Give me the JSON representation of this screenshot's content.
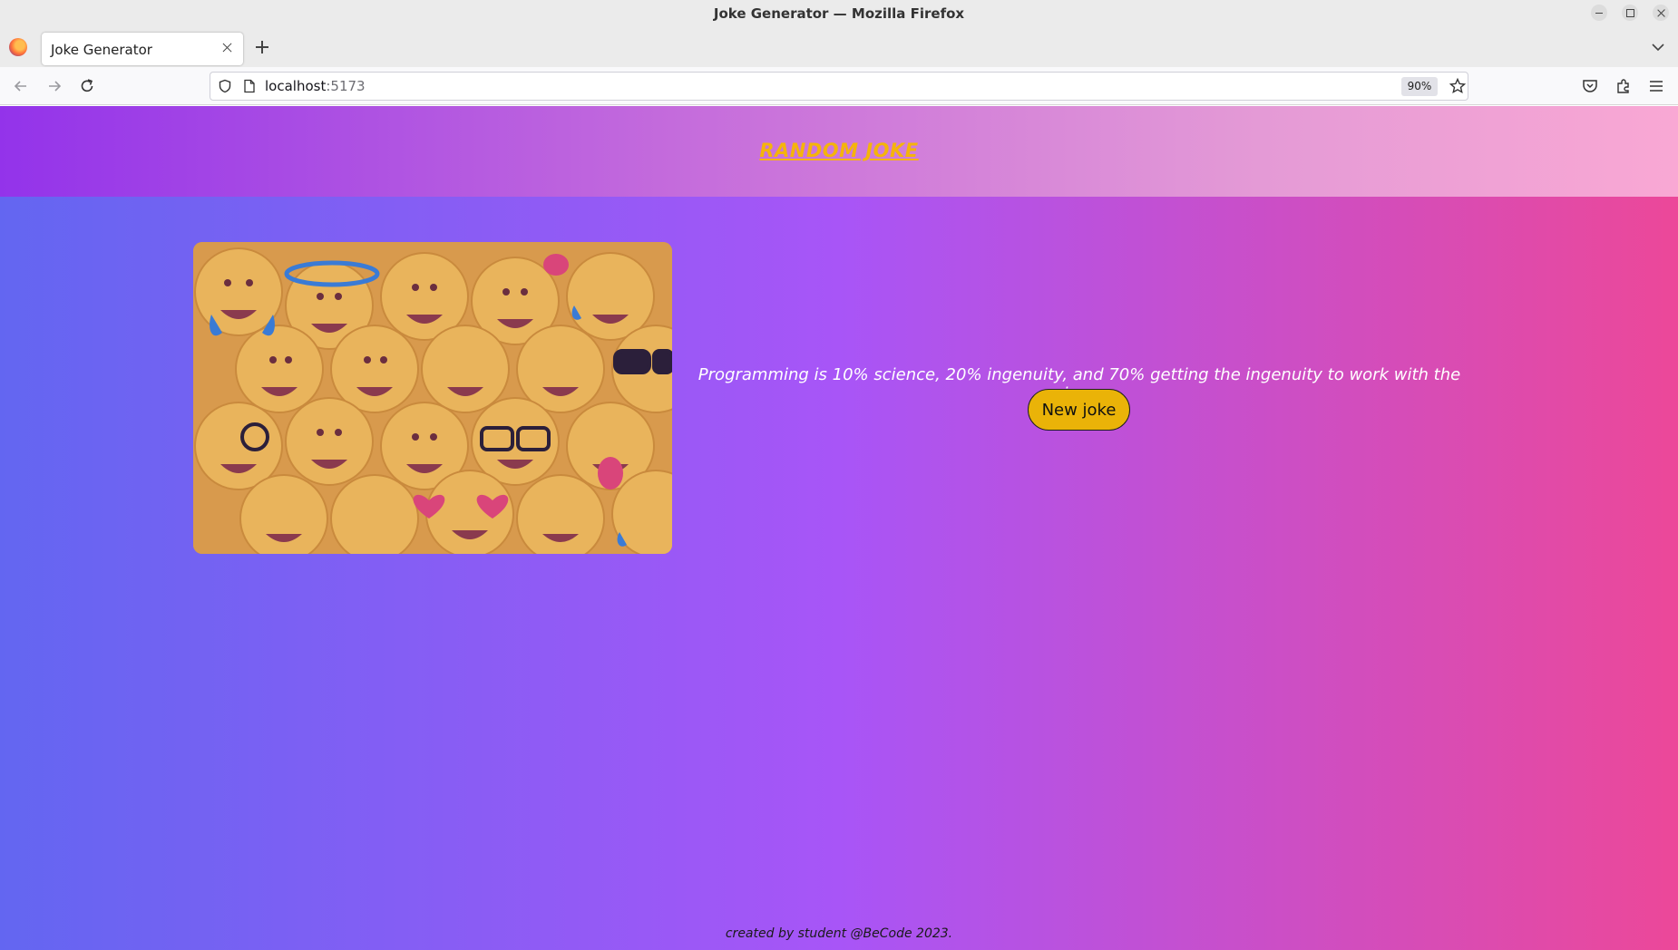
{
  "window": {
    "title": "Joke Generator — Mozilla Firefox"
  },
  "browser": {
    "tab_title": "Joke Generator",
    "url_host": "localhost",
    "url_port": ":5173",
    "zoom": "90%"
  },
  "page": {
    "header_title": "RANDOM JOKE",
    "joke_text": "Programming is 10% science, 20% ingenuity, and 70% getting the ingenuity to work with the science.",
    "new_joke_label": "New joke",
    "footer_text": "created by student @BeCode 2023."
  },
  "colors": {
    "header_title": "#f5b40b",
    "button_bg": "#eab308",
    "bg_gradient_start": "#6366f1",
    "bg_gradient_mid": "#a855f7",
    "bg_gradient_end": "#ec4899"
  },
  "icons": [
    "firefox-menu-icon",
    "close-icon",
    "new-tab-icon",
    "list-all-tabs-icon",
    "back-icon",
    "forward-icon",
    "reload-icon",
    "shield-icon",
    "page-icon",
    "bookmark-star-icon",
    "pocket-icon",
    "extensions-icon",
    "hamburger-menu-icon",
    "minimize-icon",
    "maximize-icon"
  ]
}
